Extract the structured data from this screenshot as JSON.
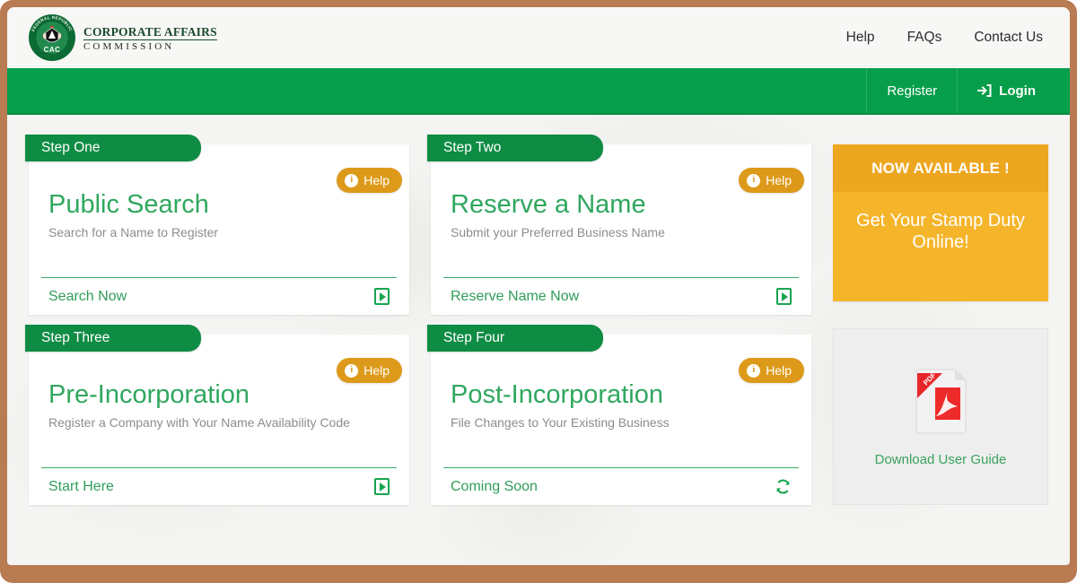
{
  "brand": {
    "seal_text": "CAC",
    "seal_arc_top": "FEDERAL REPUBLIC OF NIGERIA",
    "name_line1": "CORPORATE AFFAIRS",
    "name_line2": "COMMISSION"
  },
  "top_links": [
    {
      "label": "Help",
      "name": "help"
    },
    {
      "label": "FAQs",
      "name": "faqs"
    },
    {
      "label": "Contact Us",
      "name": "contact-us"
    }
  ],
  "nav": {
    "register_label": "Register",
    "login_label": "Login",
    "login_icon": "sign-in-icon"
  },
  "colors": {
    "frame_brown": "#b97b52",
    "nav_green": "#069e4a",
    "ribbon_green": "#0f8c44",
    "title_green": "#30a75f",
    "help_orange": "#dd9a1a",
    "promo_yellow": "#f5b52a",
    "promo_yellow_dark": "#eda61f",
    "pdf_red": "#e8262a"
  },
  "cards": [
    {
      "step": "Step One",
      "help": "Help",
      "title": "Public Search",
      "subtitle": "Search for a Name to Register",
      "action": "Search Now",
      "action_icon": "play-box-icon"
    },
    {
      "step": "Step Two",
      "help": "Help",
      "title": "Reserve a Name",
      "subtitle": "Submit your Preferred Business Name",
      "action": "Reserve Name Now",
      "action_icon": "play-box-icon"
    },
    {
      "step": "Step Three",
      "help": "Help",
      "title": "Pre-Incorporation",
      "subtitle": "Register a Company with Your Name Availability Code",
      "action": "Start Here",
      "action_icon": "play-box-icon"
    },
    {
      "step": "Step Four",
      "help": "Help",
      "title": "Post-Incorporation",
      "subtitle": "File Changes to Your Existing Business",
      "action": "Coming Soon",
      "action_icon": "refresh-icon"
    }
  ],
  "promo": {
    "headline": "NOW AVAILABLE !",
    "message": "Get Your Stamp Duty Online!"
  },
  "guide": {
    "label": "Download User Guide",
    "icon": "pdf-file-icon",
    "badge": "PDF"
  }
}
